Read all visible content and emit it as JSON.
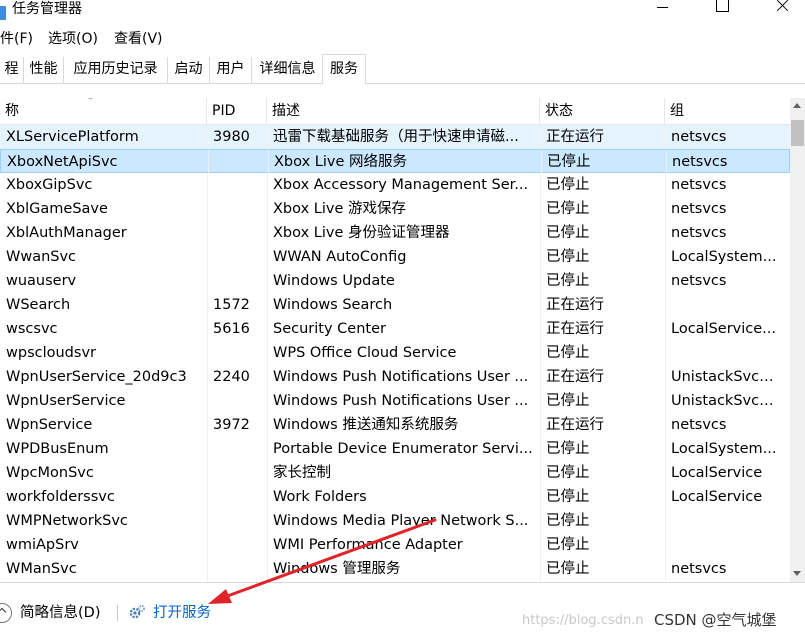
{
  "window": {
    "title": "任务管理器"
  },
  "menu": [
    "件(F)",
    "选项(O)",
    "查看(V)"
  ],
  "tabs": [
    "程",
    "性能",
    "应用历史记录",
    "启动",
    "用户",
    "详细信息",
    "服务"
  ],
  "active_tab": "服务",
  "columns": [
    "称",
    "PID",
    "描述",
    "状态",
    "组"
  ],
  "rows": [
    {
      "name": "XLServicePlatform",
      "pid": "3980",
      "desc": "迅雷下载基础服务（用于快速申请磁...",
      "status": "正在运行",
      "group": "netsvcs"
    },
    {
      "name": "XboxNetApiSvc",
      "pid": "",
      "desc": "Xbox Live 网络服务",
      "status": "已停止",
      "group": "netsvcs"
    },
    {
      "name": "XboxGipSvc",
      "pid": "",
      "desc": "Xbox Accessory Management Ser...",
      "status": "已停止",
      "group": "netsvcs"
    },
    {
      "name": "XblGameSave",
      "pid": "",
      "desc": "Xbox Live 游戏保存",
      "status": "已停止",
      "group": "netsvcs"
    },
    {
      "name": "XblAuthManager",
      "pid": "",
      "desc": "Xbox Live 身份验证管理器",
      "status": "已停止",
      "group": "netsvcs"
    },
    {
      "name": "WwanSvc",
      "pid": "",
      "desc": "WWAN AutoConfig",
      "status": "已停止",
      "group": "LocalSystem..."
    },
    {
      "name": "wuauserv",
      "pid": "",
      "desc": "Windows Update",
      "status": "已停止",
      "group": "netsvcs"
    },
    {
      "name": "WSearch",
      "pid": "1572",
      "desc": "Windows Search",
      "status": "正在运行",
      "group": ""
    },
    {
      "name": "wscsvc",
      "pid": "5616",
      "desc": "Security Center",
      "status": "正在运行",
      "group": "LocalService..."
    },
    {
      "name": "wpscloudsvr",
      "pid": "",
      "desc": "WPS Office Cloud Service",
      "status": "已停止",
      "group": ""
    },
    {
      "name": "WpnUserService_20d9c3",
      "pid": "2240",
      "desc": "Windows Push Notifications User ...",
      "status": "正在运行",
      "group": "UnistackSvcG..."
    },
    {
      "name": "WpnUserService",
      "pid": "",
      "desc": "Windows Push Notifications User ...",
      "status": "已停止",
      "group": "UnistackSvcG..."
    },
    {
      "name": "WpnService",
      "pid": "3972",
      "desc": "Windows 推送通知系统服务",
      "status": "正在运行",
      "group": "netsvcs"
    },
    {
      "name": "WPDBusEnum",
      "pid": "",
      "desc": "Portable Device Enumerator Servi...",
      "status": "已停止",
      "group": "LocalSystem..."
    },
    {
      "name": "WpcMonSvc",
      "pid": "",
      "desc": "家长控制",
      "status": "已停止",
      "group": "LocalService"
    },
    {
      "name": "workfolderssvc",
      "pid": "",
      "desc": "Work Folders",
      "status": "已停止",
      "group": "LocalService"
    },
    {
      "name": "WMPNetworkSvc",
      "pid": "",
      "desc": "Windows Media Player Network S...",
      "status": "已停止",
      "group": ""
    },
    {
      "name": "wmiApSrv",
      "pid": "",
      "desc": "WMI Performance Adapter",
      "status": "已停止",
      "group": ""
    },
    {
      "name": "WManSvc",
      "pid": "",
      "desc": "Windows 管理服务",
      "status": "已停止",
      "group": "netsvcs"
    }
  ],
  "status_bar": {
    "summary": "简略信息(D)",
    "open_services": "打开服务",
    "watermark": "https://blog.csdn.n",
    "credit": "CSDN @空气城堡"
  },
  "colors": {
    "selection": "#cce8ff",
    "link": "#0066cc",
    "annotation_arrow": "#e0242a"
  },
  "icons": [
    "app-icon",
    "minimize-icon",
    "maximize-icon",
    "close-icon",
    "sort-arrow-icon",
    "collapse-icon",
    "services-gear-icon"
  ]
}
